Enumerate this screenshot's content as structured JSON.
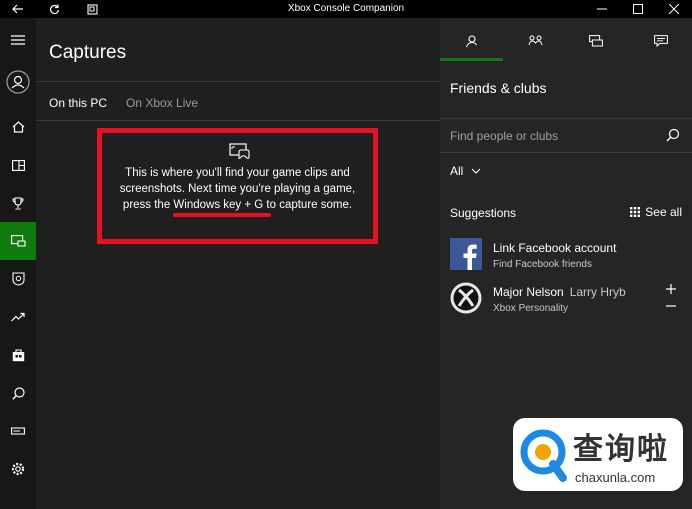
{
  "titlebar": {
    "title": "Xbox Console Companion",
    "buttons": {
      "back": "back-icon",
      "refresh": "refresh-icon",
      "snap": "snap-icon",
      "minimize": "minimize-icon",
      "maximize": "maximize-icon",
      "close": "close-icon"
    }
  },
  "rail": {
    "items": [
      {
        "name": "menu",
        "icon": "hamburger-icon"
      },
      {
        "name": "profile",
        "icon": "profile-icon"
      },
      {
        "name": "home",
        "icon": "home-icon"
      },
      {
        "name": "my-games",
        "icon": "games-icon"
      },
      {
        "name": "achievements",
        "icon": "trophy-icon"
      },
      {
        "name": "captures",
        "icon": "captures-icon",
        "active": true
      },
      {
        "name": "clubs",
        "icon": "clubs-icon"
      },
      {
        "name": "trending",
        "icon": "trending-icon"
      },
      {
        "name": "store",
        "icon": "store-icon"
      },
      {
        "name": "search",
        "icon": "search-icon"
      },
      {
        "name": "connection",
        "icon": "console-icon"
      },
      {
        "name": "settings",
        "icon": "gear-icon"
      }
    ]
  },
  "main": {
    "title": "Captures",
    "tabs": [
      {
        "label": "On this PC",
        "selected": true
      },
      {
        "label": "On Xbox Live",
        "selected": false
      }
    ],
    "empty_state": {
      "line1": "This is where you'll find your game clips and",
      "line2": "screenshots. Next time you're playing a game,",
      "line3": "press the Windows key + G to capture some."
    }
  },
  "panel": {
    "tabs": [
      "friends-icon",
      "party-icon",
      "messages-icon",
      "activity-icon"
    ],
    "heading": "Friends & clubs",
    "search": {
      "placeholder": "Find people or clubs",
      "value": ""
    },
    "filter": {
      "selected": "All"
    },
    "suggestions_label": "Suggestions",
    "see_all_label": "See all",
    "suggestions": [
      {
        "name": "Link Facebook account",
        "alt": "",
        "sub": "Find Facebook friends",
        "avatar": "facebook-icon"
      },
      {
        "name": "Major Nelson",
        "alt": "Larry Hryb",
        "sub": "Xbox Personality",
        "avatar": "xbox-icon"
      }
    ]
  },
  "watermark": {
    "cn": "查询啦",
    "en": "chaxunla.com"
  },
  "colors": {
    "accent": "#107c10",
    "annotation": "#e81123",
    "background": "#1f1f1f",
    "panel": "#252525",
    "titlebar": "#000000",
    "facebook": "#3b5998"
  }
}
